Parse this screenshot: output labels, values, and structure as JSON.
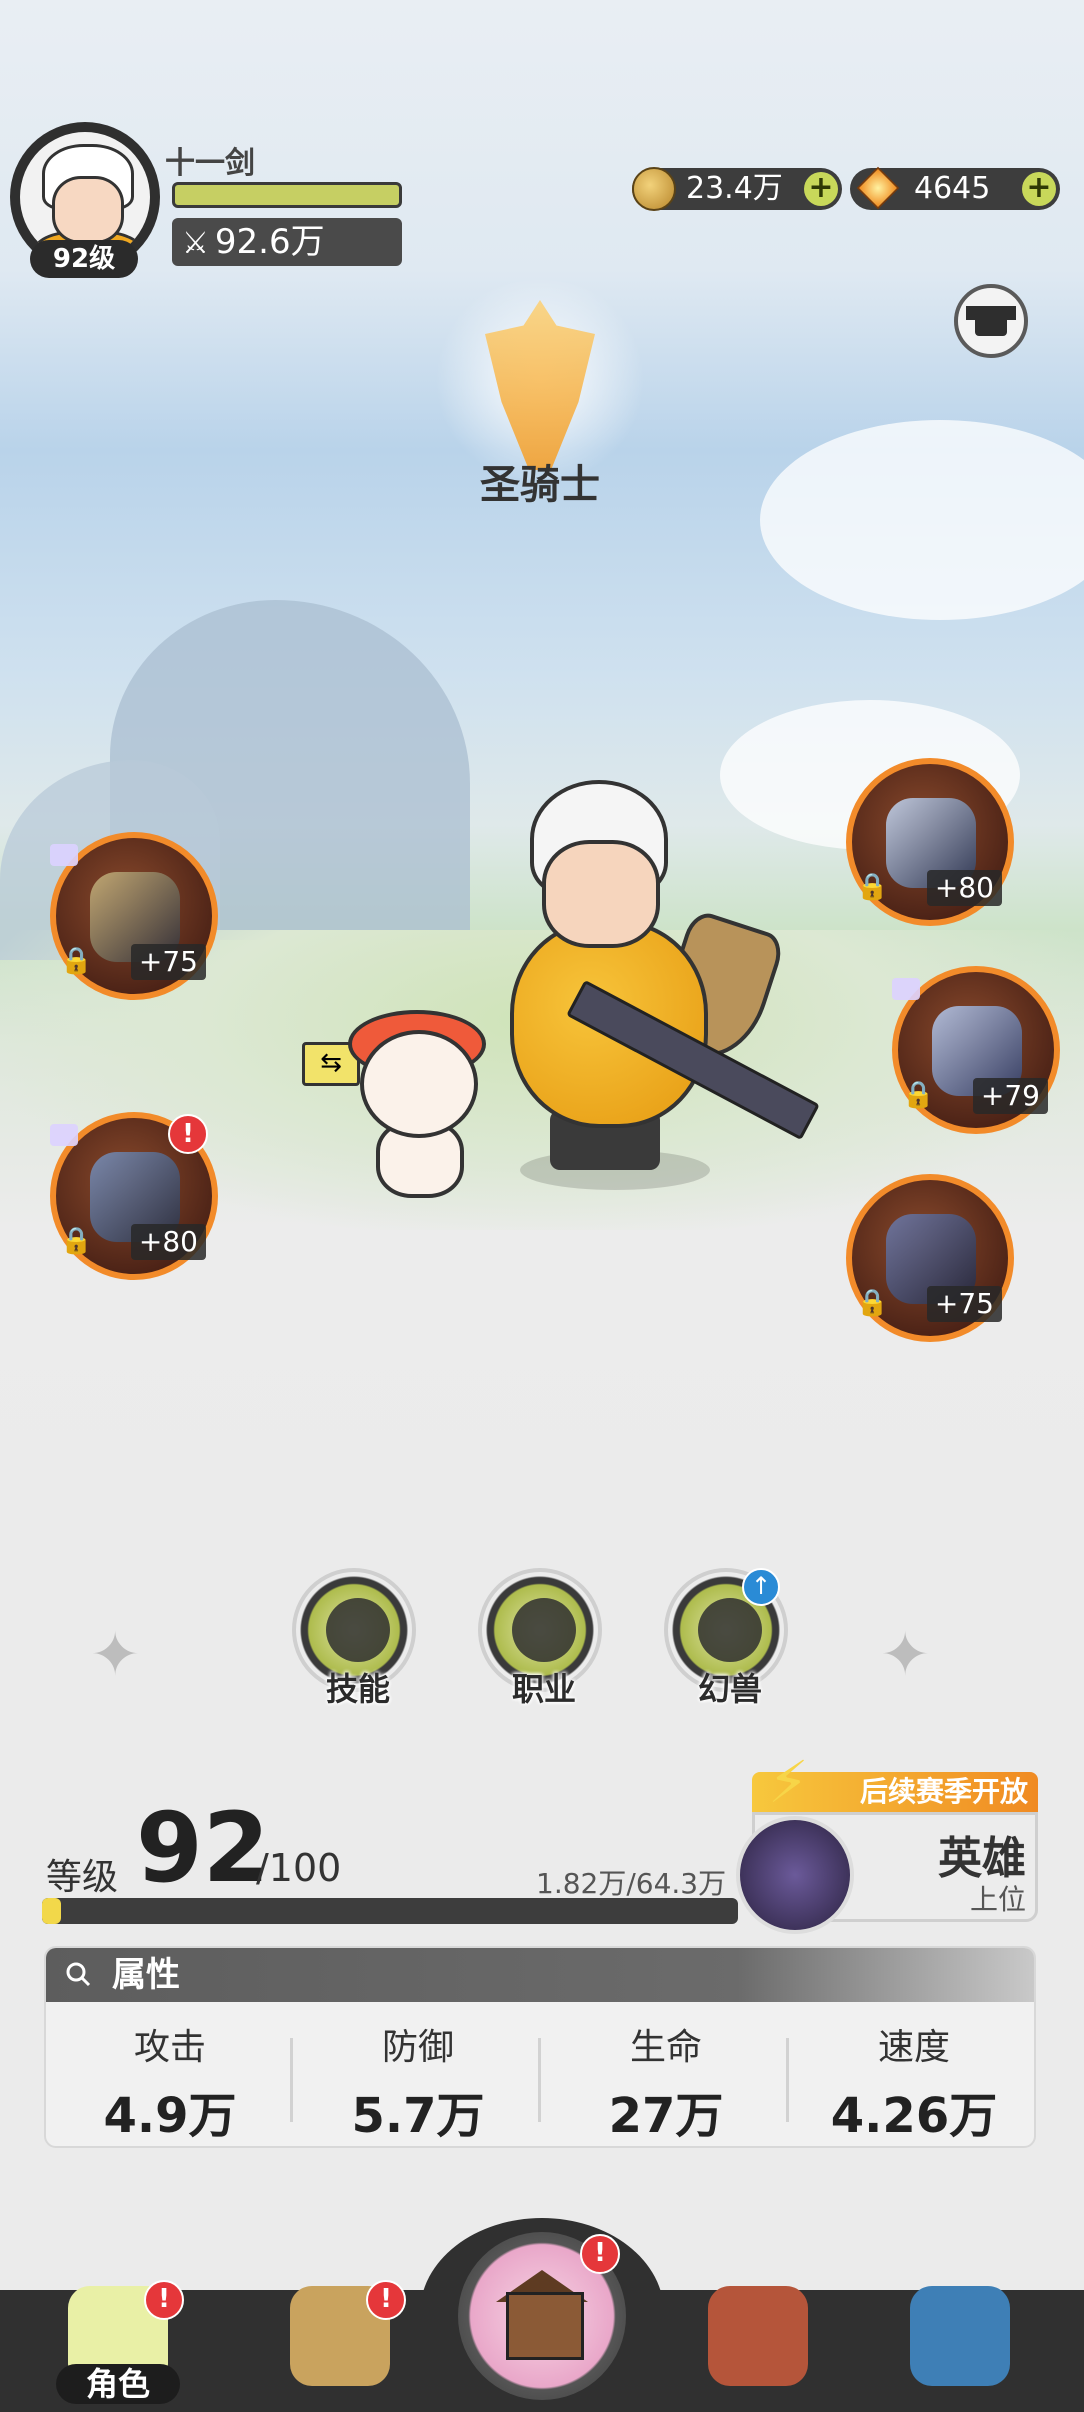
{
  "player": {
    "name": "十一剑",
    "level_badge": "92级",
    "power": "92.6万"
  },
  "currency": {
    "gold": "23.4万",
    "gems": "4645"
  },
  "class_name": "圣骑士",
  "equipment": {
    "left": [
      {
        "level": "+75",
        "alert": ""
      },
      {
        "level": "+80",
        "alert": "!"
      }
    ],
    "right": [
      {
        "level": "+80"
      },
      {
        "level": "+79"
      },
      {
        "level": "+75"
      }
    ]
  },
  "functions": {
    "skill": "技能",
    "job": "职业",
    "beast": "幻兽"
  },
  "level_panel": {
    "label": "等级",
    "level": "92",
    "max": "/100",
    "exp": "1.82万/64.3万",
    "progress_percent": 2.8
  },
  "season": {
    "tag": "后续赛季开放",
    "title": "英雄",
    "subtitle": "上位"
  },
  "attributes": {
    "header": "属性",
    "items": [
      {
        "name": "攻击",
        "value": "4.9万"
      },
      {
        "name": "防御",
        "value": "5.7万"
      },
      {
        "name": "生命",
        "value": "27万"
      },
      {
        "name": "速度",
        "value": "4.26万"
      }
    ]
  },
  "nav": {
    "role": "角色",
    "alert": "!"
  },
  "colors": {
    "accent_green": "#c6cf63",
    "alert_red": "#e5373a",
    "slot_border": "#f28b2a"
  }
}
